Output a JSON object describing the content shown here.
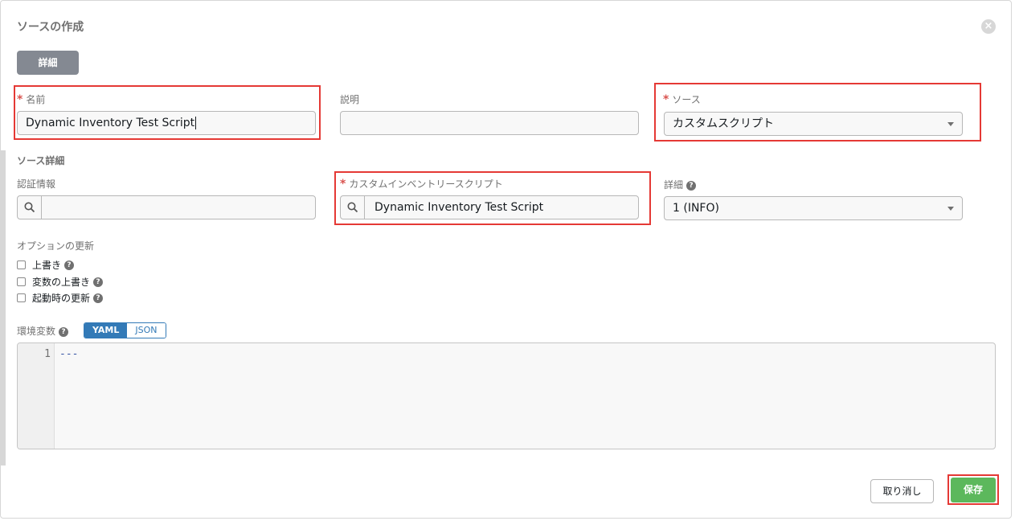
{
  "dialog": {
    "title": "ソースの作成",
    "close_icon": "close-icon",
    "details_tab": "詳細"
  },
  "form": {
    "name": {
      "label": "名前",
      "value": "Dynamic Inventory Test Script",
      "required": true
    },
    "description": {
      "label": "説明",
      "value": ""
    },
    "source": {
      "label": "ソース",
      "value": "カスタムスクリプト",
      "required": true
    },
    "source_details_title": "ソース詳細",
    "credential": {
      "label": "認証情報",
      "value": ""
    },
    "custom_script": {
      "label": "カスタムインベントリースクリプト",
      "value": "Dynamic Inventory Test Script",
      "required": true
    },
    "verbosity": {
      "label": "詳細",
      "value": "1 (INFO)"
    },
    "update_options": {
      "label": "オプションの更新",
      "items": [
        {
          "label": "上書き",
          "checked": false
        },
        {
          "label": "変数の上書き",
          "checked": false
        },
        {
          "label": "起動時の更新",
          "checked": false
        }
      ]
    },
    "env_vars": {
      "label": "環境変数",
      "toggle_yaml": "YAML",
      "toggle_json": "JSON",
      "active": "YAML",
      "line_number": "1",
      "code": "---"
    }
  },
  "actions": {
    "cancel": "取り消し",
    "save": "保存"
  },
  "colors": {
    "highlight": "#e53935",
    "save_button": "#5cb85c",
    "toggle_active": "#337ab7",
    "details_tab": "#848992"
  }
}
